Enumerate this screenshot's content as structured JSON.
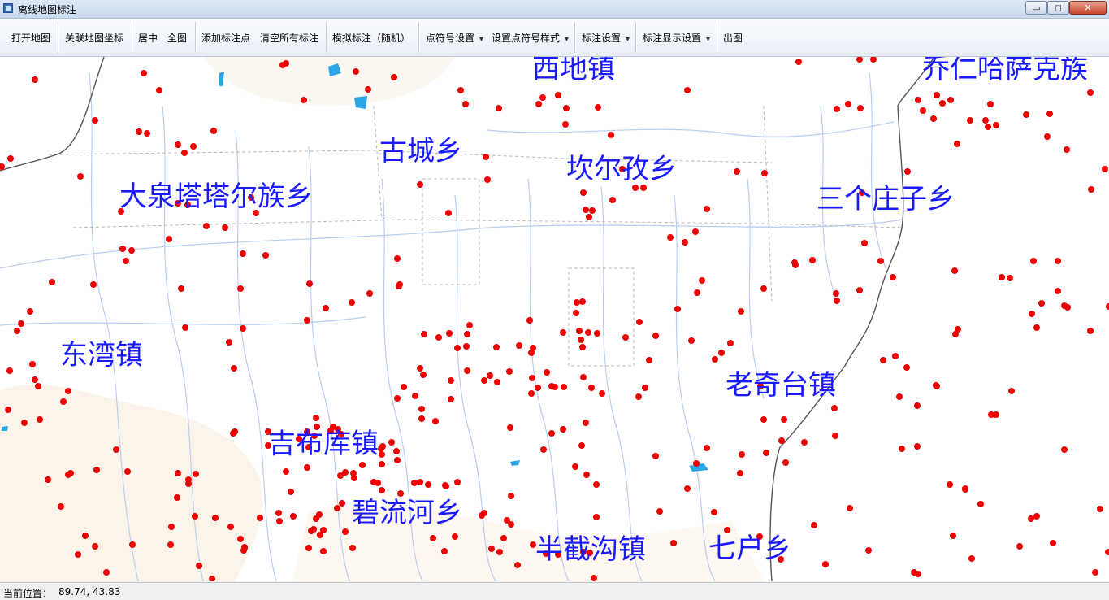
{
  "window": {
    "title": "离线地图标注",
    "min_glyph": "▭",
    "max_glyph": "◻",
    "close_glyph": "✕",
    "icon": "map-app-icon"
  },
  "toolbar": {
    "open_map": "打开地图",
    "link_coords": "关联地图坐标",
    "center": "居中",
    "full_view": "全图",
    "add_point": "添加标注点",
    "clear_all": "清空所有标注",
    "simulate": "模拟标注（随机）",
    "symbol_settings": "点符号设置",
    "symbol_style": "设置点符号样式",
    "label_settings": "标注设置",
    "label_display": "标注显示设置",
    "export": "出图"
  },
  "map": {
    "labels": [
      "西地镇",
      "乔仁哈萨克族",
      "古城乡",
      "坎尔孜乡",
      "大泉塔塔尔族乡",
      "三个庄子乡",
      "东湾镇",
      "老奇台镇",
      "吉布库镇",
      "碧流河乡",
      "半截沟镇",
      "七户乡"
    ],
    "marker_color": "#ee0000",
    "label_color": "#1a1aff",
    "river_color": "#b7cdf0",
    "boundary_color": "#555555"
  },
  "status": {
    "label": "当前位置：",
    "coords": "89.74, 43.83"
  }
}
